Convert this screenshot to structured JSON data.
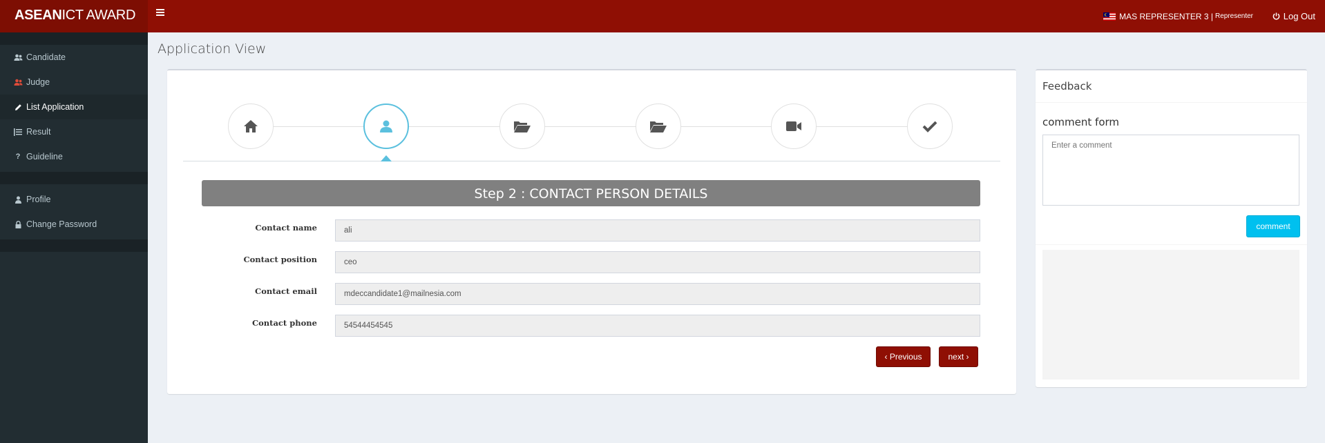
{
  "header": {
    "logo_bold": "ASEAN",
    "logo_rest": "ICT AWARD",
    "user_name": "MAS REPRESENTER 3 |",
    "user_role": "Representer",
    "logout_label": "Log Out"
  },
  "sidebar": {
    "items": [
      {
        "label": "Candidate",
        "icon": "users-icon"
      },
      {
        "label": "Judge",
        "icon": "users-icon"
      },
      {
        "label": "List Application",
        "icon": "pencil-icon"
      },
      {
        "label": "Result",
        "icon": "list-icon"
      },
      {
        "label": "Guideline",
        "icon": "question-icon"
      }
    ],
    "account_items": [
      {
        "label": "Profile",
        "icon": "user-icon"
      },
      {
        "label": "Change Password",
        "icon": "lock-icon"
      }
    ]
  },
  "page": {
    "title": "Application View"
  },
  "wizard": {
    "steps": [
      "home-icon",
      "user-icon",
      "folder-open-icon",
      "folder-open-icon",
      "video-camera-icon",
      "check-icon"
    ],
    "active_step": 2,
    "banner": "Step 2 : CONTACT PERSON DETAILS"
  },
  "form": {
    "fields": [
      {
        "label": "Contact name",
        "value": "ali"
      },
      {
        "label": "Contact position",
        "value": "ceo"
      },
      {
        "label": "Contact email",
        "value": "mdeccandidate1@mailnesia.com"
      },
      {
        "label": "Contact phone",
        "value": "54544454545"
      }
    ],
    "previous_label": "Previous",
    "next_label": "next"
  },
  "feedback": {
    "title": "Feedback",
    "form_title": "comment form",
    "placeholder": "Enter a comment",
    "button_label": "comment"
  },
  "colors": {
    "header": "#8f0f04",
    "sidebar": "#222d32",
    "accent": "#5bc0de",
    "comment_button": "#00c0ef"
  }
}
